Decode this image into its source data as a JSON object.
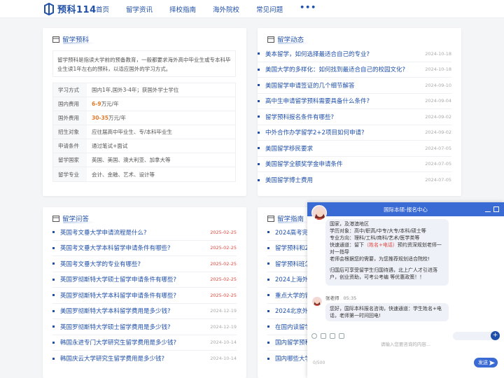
{
  "brand": {
    "logo_text": "预科114",
    "accent": "#1f4fa8"
  },
  "nav": {
    "items": [
      "首页",
      "留学资讯",
      "择校指南",
      "海外院校",
      "常见问题"
    ],
    "more": "•••"
  },
  "cards": {
    "prep": {
      "title": "留学预科",
      "intro": "留学预科是指读大学前的预备教育，一般都要求海外高中毕业生或专本科毕业生读1年左右的预科，以适应国外的学习方式。",
      "rows": [
        {
          "k": "学习方式",
          "v": "国内1年,国外3-4年；获国外学士学位"
        },
        {
          "k": "国内费用",
          "v_hl": "6-9",
          "v": "万元/年"
        },
        {
          "k": "国外费用",
          "v_hl": "30-35",
          "v": "万元/年"
        },
        {
          "k": "招生对象",
          "v": "应往届高中毕业生、专/本科毕业生"
        },
        {
          "k": "申请条件",
          "v": "通过笔试+面试"
        },
        {
          "k": "留学国家",
          "v": "英国、美国、澳大利亚、加拿大等"
        },
        {
          "k": "留学专业",
          "v": "会计、金融、艺术、设计等"
        }
      ]
    },
    "news": {
      "title": "留学动态",
      "items": [
        {
          "text": "美本留学，如何选择最适合自己的专业?",
          "date": "2024-10-18"
        },
        {
          "text": "美国大学的多样化：如何找到最适合自己的校园文化?",
          "date": "2024-10-18"
        },
        {
          "text": "美国留学申请签证的几个细节解答",
          "date": "2024-09-10"
        },
        {
          "text": "高中生申请留学预科需要具备什么条件?",
          "date": "2024-09-04"
        },
        {
          "text": "留学预科报名条件有哪些?",
          "date": "2024-09-02"
        },
        {
          "text": "中外合作办学留学2+2项目如何申请?",
          "date": "2024-09-02"
        },
        {
          "text": "美国留学移民要求",
          "date": "2024-07-05"
        },
        {
          "text": "美国留学全额奖学金申请条件",
          "date": "2024-07-05"
        },
        {
          "text": "美国留学博士费用",
          "date": "2024-07-05"
        }
      ]
    },
    "qa": {
      "title": "留学问答",
      "items": [
        {
          "text": "英国考文垂大学申请流程是什么?",
          "date": "2025-02-25",
          "red": true
        },
        {
          "text": "英国考文垂大学本科留学申请条件有哪些?",
          "date": "2025-02-25",
          "red": true
        },
        {
          "text": "英国考文垂大学的专业有哪些?",
          "date": "2025-02-25",
          "red": true
        },
        {
          "text": "英国罗彻斯特大学硕士留学申请条件有哪些?",
          "date": "2025-02-25",
          "red": true
        },
        {
          "text": "英国罗彻斯特大学本科留学申请条件有哪些?",
          "date": "2025-02-25",
          "red": true
        },
        {
          "text": "美国罗彻斯特大学本科留学费用是多少钱?",
          "date": "2024-12-19",
          "red": false
        },
        {
          "text": "英国罗彻斯特大学硕士留学费用是多少钱?",
          "date": "2024-12-19",
          "red": false
        },
        {
          "text": "韩国永进专门大学研究生留学费用是多少钱?",
          "date": "2024-10-14",
          "red": false
        },
        {
          "text": "韩国庆云大学研究生留学费用是多少钱?",
          "date": "2024-10-14",
          "red": false
        }
      ]
    },
    "guide": {
      "title": "留学指南",
      "items": [
        {
          "text": "2024高考完后"
        },
        {
          "text": "留学预科和2+"
        },
        {
          "text": "留学预科班怎"
        },
        {
          "text": "2024上海外国"
        },
        {
          "text": "重点大学的留"
        },
        {
          "text": "2024北京外国"
        },
        {
          "text": "在国内读留学"
        },
        {
          "text": "国内留学预科"
        },
        {
          "text": "国内哪些大学"
        }
      ]
    }
  },
  "chat": {
    "title": "国际本硕-报名中心",
    "msg1_lines": [
      "国家，及港澳地区",
      "学历对象：高中/职高/中专/大专/本科/硕士等",
      "专业方向：理科/工科/商科/艺术/医学类等",
      "快速通道：留下",
      "（姓名+电话）",
      "预约资深规划老师一",
      "对一指导",
      "老师会根据您的需要，为您推荐规划适合院校!",
      "归国后可享受留学生归国待遇，北上广人才引进落",
      "户，创业资助，可考公考编 等优惠政策！！"
    ],
    "agent_name": "张老师",
    "agent_time": "05:35",
    "msg2": "您好，国际本科报名咨询，快速通道：学生姓名+电话，老师第一时间回电!",
    "input_placeholder": "请输入您要咨询的内容...",
    "counter": "0/500",
    "send_label": "发送",
    "quick_plus": "+"
  }
}
